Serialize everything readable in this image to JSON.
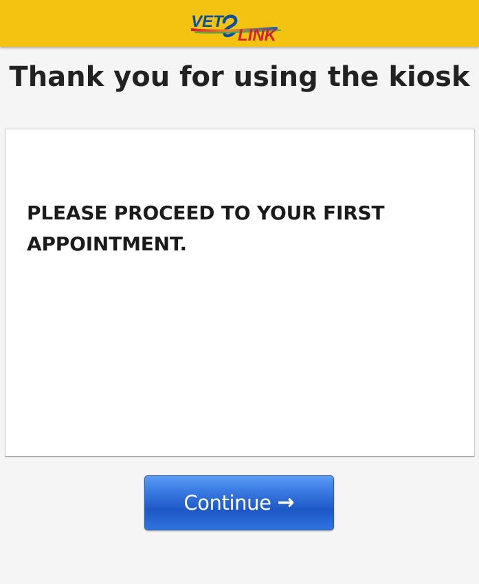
{
  "header": {
    "logo": {
      "text_left": "VET",
      "text_right": "LINK",
      "icon": "vetlink-logo-icon",
      "colors": {
        "blue": "#0b4f9f",
        "red": "#d4212a",
        "green": "#38a85d",
        "yellow": "#f4c30f"
      }
    }
  },
  "main": {
    "title": "Thank you for using the kiosk",
    "message": "PLEASE PROCEED TO YOUR FIRST APPOINTMENT."
  },
  "actions": {
    "continue_label": "Continue",
    "continue_icon": "arrow-right-icon",
    "continue_arrow": "→"
  },
  "colors": {
    "header_background": "#f4c30f",
    "page_background": "#f5f5f5",
    "button_blue": "#2f73de"
  }
}
